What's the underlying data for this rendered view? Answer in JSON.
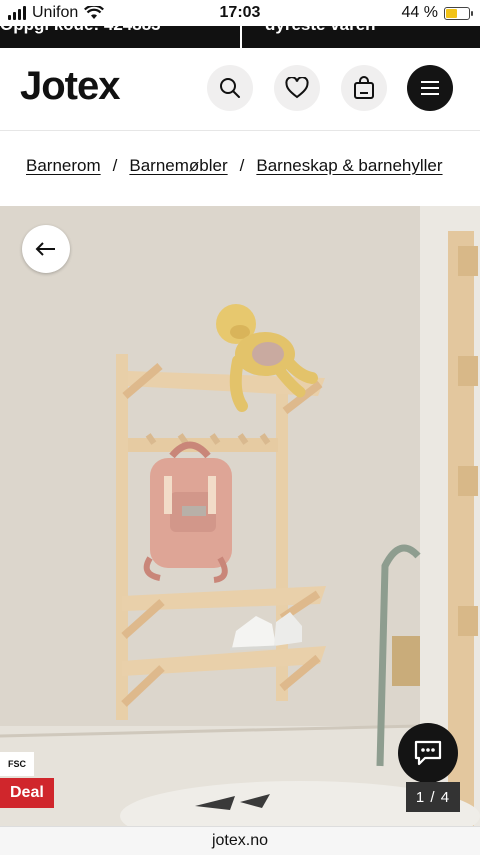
{
  "status": {
    "carrier": "Unifon",
    "time": "17:03",
    "battery_text": "44 %",
    "battery_level": 0.44
  },
  "promo": {
    "left_text": "Oppgi kode: 424883",
    "right_text": "dyreste varen"
  },
  "header": {
    "logo": "Jotex",
    "icons": [
      "search-icon",
      "heart-icon",
      "bag-icon",
      "menu-icon"
    ]
  },
  "breadcrumb": {
    "items": [
      "Barnerom",
      "Barnemøbler",
      "Barneskap & barnehyller"
    ],
    "separator": "/"
  },
  "gallery": {
    "fsc": "FSC",
    "deal": "Deal",
    "counter": "1 / 4"
  },
  "browser": {
    "url": "jotex.no"
  },
  "colors": {
    "deal": "#d0262c",
    "brand": "#111111",
    "wall": "#dcd6cc",
    "wood": "#e8cfa8"
  }
}
